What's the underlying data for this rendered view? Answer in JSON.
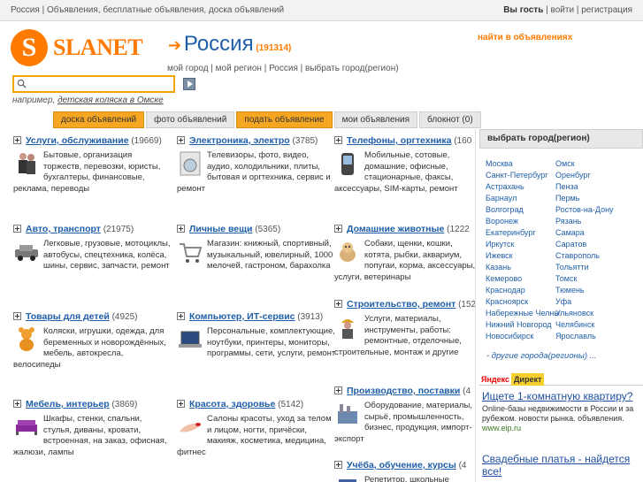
{
  "topbar": {
    "left_text": "Россия | Объявления, бесплатные объявления, доска объявлений",
    "greeting": "Вы гость",
    "sep1": "|",
    "login": "войти",
    "sep2": "|",
    "register": "регистрация"
  },
  "logo": {
    "letter": "S",
    "text": "SLANET"
  },
  "region": {
    "arrow": "➔",
    "name": "Россия",
    "count": "(191314)",
    "links": "мой город | мой регион | Россия | выбрать город(регион)"
  },
  "find_link": "найти в объявлениях",
  "search": {
    "value": "",
    "placeholder": ""
  },
  "example": {
    "prefix": "например,",
    "link": "детская коляска в Омске"
  },
  "tabs": [
    {
      "label": "доска объявлений",
      "active": true
    },
    {
      "label": "фото объявлений",
      "active": false
    },
    {
      "label": "подать объявление",
      "active": true
    },
    {
      "label": "мои объявления",
      "active": false
    },
    {
      "label": "блокнот (0)",
      "active": false
    }
  ],
  "categories": [
    {
      "title": "Услуги, обслуживание",
      "count": "(19669)",
      "icon": "business-people-icon",
      "text": "Бытовые, организация торжеств, перевозки, юристы, бухгалтеры, финансовые, реклама, переводы"
    },
    {
      "title": "Электроника, электро",
      "count": "(3785)",
      "icon": "washing-machine-icon",
      "text": "Телевизоры, фото, видео, аудио, холодильники, плиты, бытовая и оргтехника, сервис и ремонт"
    },
    {
      "title": "Телефоны, оргтехника",
      "count": "(160",
      "icon": "phone-icon",
      "text": "Мобильные, сотовые, домашние, офисные, стационарные, факсы, аксессуары, SIM-карты, ремонт"
    },
    {
      "title": "Авто, транспорт",
      "count": "(21975)",
      "icon": "car-icon",
      "text": "Легковые, грузовые, мотоциклы, автобусы, спецтехника, колёса, шины, сервис, запчасти, ремонт"
    },
    {
      "title": "Личные вещи",
      "count": "(5365)",
      "icon": "shopping-cart-icon",
      "text": "Магазин: книжный, спортивный, музыкальный, ювелирный, 1000 мелочей, гастроном, барахолка"
    },
    {
      "title": "Домашние животные",
      "count": "(1222",
      "icon": "dog-icon",
      "text": "Собаки, щенки, кошки, котята, рыбки, аквариум, попугаи, корма, аксессуары, услуги, ветеринары"
    },
    {
      "title": "Товары для детей",
      "count": "(4925)",
      "icon": "teddy-bear-icon",
      "text": "Коляски, игрушки, одежда, для беременных и новорождённых, мебель, автокресла, велосипеды"
    },
    {
      "title": "Компьютер, ИТ-сервис",
      "count": "(3913)",
      "icon": "laptop-icon",
      "text": "Персональные, комплектующие, ноутбуки, принтеры, мониторы, программы, сети, услуги, ремонт"
    },
    {
      "title": "Строительство, ремонт",
      "count": "(152",
      "icon": "worker-icon",
      "text": "Услуги, материалы, инструменты, работы: ремонтные, отделочные, строительные, монтаж и другие"
    },
    {
      "title": "Мебель, интерьер",
      "count": "(3869)",
      "icon": "sofa-icon",
      "text": "Шкафы, стенки, спальни, стулья, диваны, кровати, встроенная, на заказ, офисная, жалюзи, лампы"
    },
    {
      "title": "Красота, здоровье",
      "count": "(5142)",
      "icon": "manicure-icon",
      "text": "Салоны красоты, уход за телом и лицом, ногти, причёски, макияж, косметика, медицина, фитнес"
    },
    {
      "title": "Производство, поставки",
      "count": "(4",
      "icon": "factory-icon",
      "text": "Оборудование, материалы, сырьё, промышленность, бизнес, продукция, импорт-экспорт"
    },
    {
      "title": "Учёба, обучение, курсы",
      "count": "(4",
      "icon": "book-icon",
      "text": "Репетитор, школьные"
    }
  ],
  "sidebar": {
    "title": "выбрать город(регион)",
    "cities_left": [
      "Москва",
      "Санкт-Петербург",
      "Астрахань",
      "Барнаул",
      "Волгоград",
      "Воронеж",
      "Екатеринбург",
      "Иркутск",
      "Ижевск",
      "Казань",
      "Кемерово",
      "Краснодар",
      "Красноярск",
      "Набережные Челны",
      "Нижний Новгород",
      "Новосибирск"
    ],
    "cities_right": [
      "Омск",
      "Оренбург",
      "Пенза",
      "Пермь",
      "Ростов-на-Дону",
      "Рязань",
      "Самара",
      "Саратов",
      "Ставрополь",
      "Тольятти",
      "Томск",
      "Тюмень",
      "Уфа",
      "Ульяновск",
      "Челябинск",
      "Ярославль"
    ],
    "other": "- другие города(регионы) ..."
  },
  "ads": {
    "ya": "Я",
    "ya_rest": "ндекс",
    "direct": "Директ",
    "items": [
      {
        "title": "Ищете 1-комнатную квартиру?",
        "text": "Online-базы недвижимости в России и за рубежом. новости рынка. объявления.",
        "url": "www.eip.ru"
      },
      {
        "title": "Свадебные платья - найдется все!",
        "text": "",
        "url": ""
      }
    ]
  },
  "colors": {
    "accent": "#ff7a00",
    "link": "#1f5ea8",
    "tab_active": "#f5a623"
  }
}
